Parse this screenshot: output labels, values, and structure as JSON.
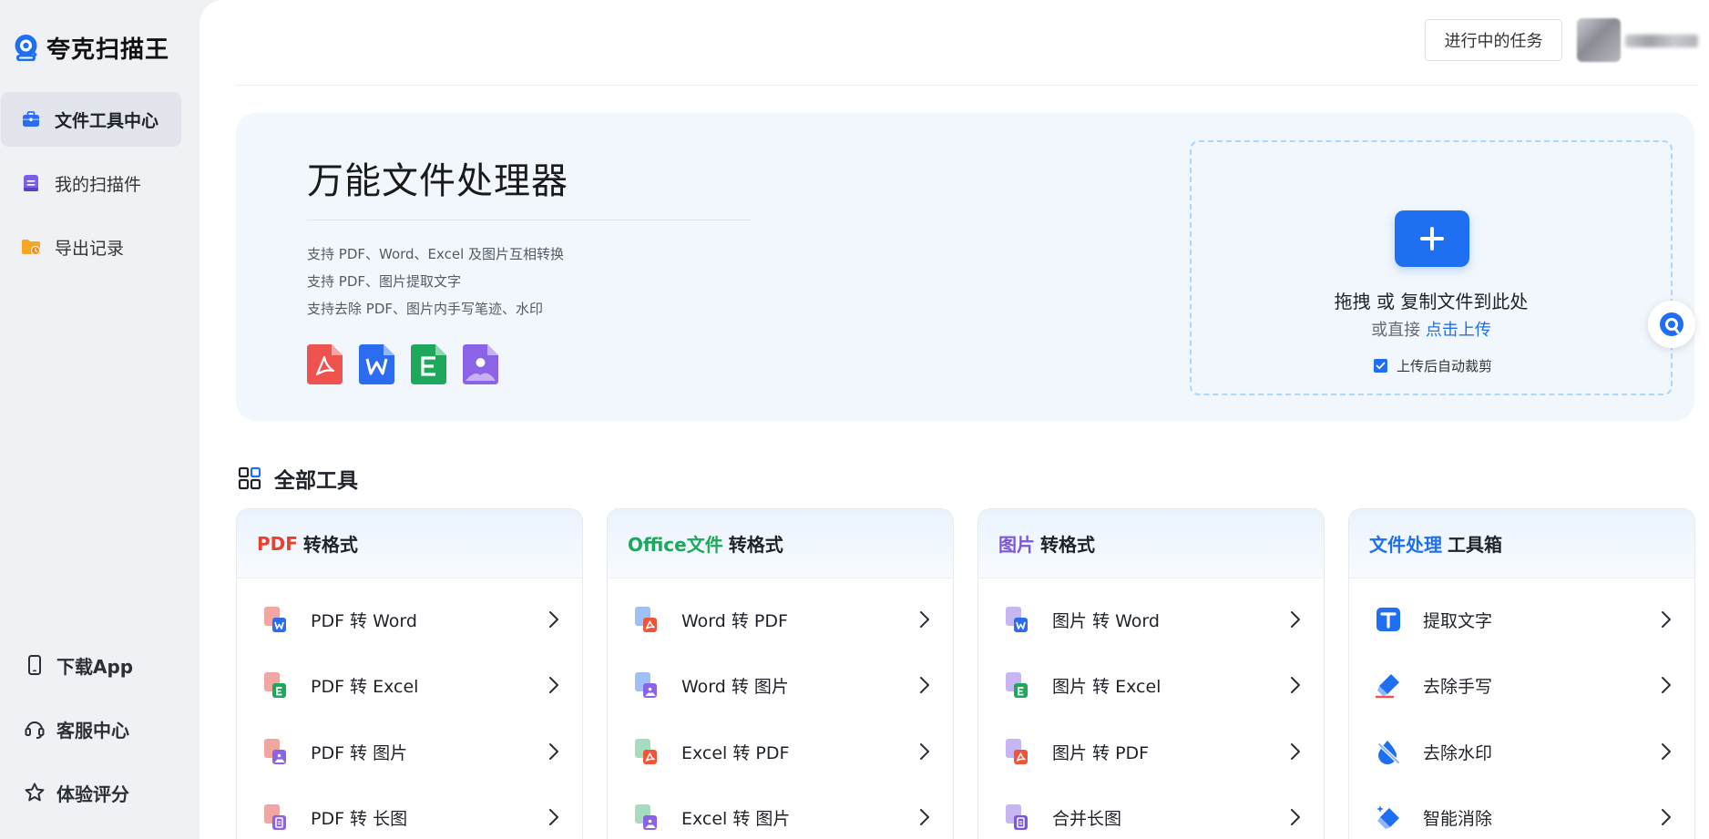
{
  "brand": {
    "name": "夸克扫描王"
  },
  "sidebar": {
    "items": [
      {
        "label": "文件工具中心",
        "icon": "briefcase-icon",
        "active": true
      },
      {
        "label": "我的扫描件",
        "icon": "document-icon",
        "active": false
      },
      {
        "label": "导出记录",
        "icon": "folder-clock-icon",
        "active": false
      }
    ],
    "bottom": [
      {
        "label": "下载App",
        "icon": "phone-icon"
      },
      {
        "label": "客服中心",
        "icon": "headset-icon"
      },
      {
        "label": "体验评分",
        "icon": "star-icon"
      }
    ]
  },
  "header": {
    "task_button": "进行中的任务"
  },
  "hero": {
    "title": "万能文件处理器",
    "features": [
      "支持 PDF、Word、Excel 及图片互相转换",
      "支持 PDF、图片提取文字",
      "支持去除 PDF、图片内手写笔迹、水印"
    ],
    "upload": {
      "main": "拖拽 或 复制文件到此处",
      "sub_prefix": "或直接",
      "sub_link": "点击上传",
      "autocrop_label": "上传后自动裁剪",
      "autocrop_checked": true
    }
  },
  "tools": {
    "title": "全部工具",
    "cards": [
      {
        "accent": "PDF",
        "accent_color": "#e8412e",
        "title": "转格式",
        "items": [
          {
            "label": "PDF 转 Word",
            "icon": "pdf-to-word-icon",
            "badge": "#2c6cf0"
          },
          {
            "label": "PDF 转 Excel",
            "icon": "pdf-to-excel-icon",
            "badge": "#1ea85c"
          },
          {
            "label": "PDF 转 图片",
            "icon": "pdf-to-image-icon",
            "badge": "#8a63e6"
          },
          {
            "label": "PDF 转 长图",
            "icon": "pdf-to-longimage-icon",
            "badge": "#8a63e6"
          }
        ]
      },
      {
        "accent": "Office文件",
        "accent_color": "#1ea85c",
        "title": "转格式",
        "items": [
          {
            "label": "Word 转 PDF",
            "icon": "word-to-pdf-icon",
            "badge": "#f0553a"
          },
          {
            "label": "Word 转 图片",
            "icon": "word-to-image-icon",
            "badge": "#8a63e6"
          },
          {
            "label": "Excel 转 PDF",
            "icon": "excel-to-pdf-icon",
            "badge": "#f0553a"
          },
          {
            "label": "Excel 转 图片",
            "icon": "excel-to-image-icon",
            "badge": "#8a63e6"
          }
        ]
      },
      {
        "accent": "图片",
        "accent_color": "#7b57e0",
        "title": "转格式",
        "items": [
          {
            "label": "图片 转 Word",
            "icon": "image-to-word-icon",
            "badge": "#2c6cf0"
          },
          {
            "label": "图片 转 Excel",
            "icon": "image-to-excel-icon",
            "badge": "#1ea85c"
          },
          {
            "label": "图片 转 PDF",
            "icon": "image-to-pdf-icon",
            "badge": "#f0553a"
          },
          {
            "label": "合并长图",
            "icon": "merge-longimage-icon",
            "badge": "#7b57e0"
          }
        ]
      },
      {
        "accent": "文件处理",
        "accent_color": "#1f6ff2",
        "title": "工具箱",
        "items": [
          {
            "label": "提取文字",
            "icon": "extract-text-icon",
            "badge": "#1f6ff2"
          },
          {
            "label": "去除手写",
            "icon": "remove-handwriting-icon",
            "badge": "#1f6ff2"
          },
          {
            "label": "去除水印",
            "icon": "remove-watermark-icon",
            "badge": "#1f6ff2"
          },
          {
            "label": "智能消除",
            "icon": "smart-erase-icon",
            "badge": "#1f6ff2"
          }
        ]
      }
    ]
  }
}
